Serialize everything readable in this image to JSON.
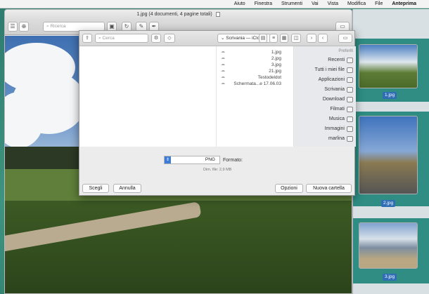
{
  "menubar": {
    "items": [
      "Anteprima",
      "File",
      "Modifica",
      "Vista",
      "Vai",
      "Strumenti",
      "Finestra",
      "Aiuto"
    ]
  },
  "window": {
    "title": "1.jpg (4 documenti, 4 pagine totali)",
    "search_placeholder": "Ricerca"
  },
  "thumbnails": [
    {
      "label": "1.jpg"
    },
    {
      "label": "2.jpg"
    },
    {
      "label": "3.jpg"
    }
  ],
  "dialog": {
    "search_placeholder": "Cerca",
    "location": "Scrivania — iCloud",
    "files": [
      "1.jpg",
      "2.jpg",
      "3.jpg",
      "21.jpg",
      "Testodeldot",
      "Schermata...e 17.06.03"
    ],
    "sidebar_header": "Preferiti",
    "sidebar_items": [
      "Recenti",
      "Tutti i miei file",
      "Applicazioni",
      "Scrivania",
      "Download",
      "Filmati",
      "Musica",
      "Immagini",
      "marlina"
    ],
    "format_label": "Formato:",
    "format_value": "PNG",
    "file_size": "Dim. file: 2,9 MB",
    "buttons": {
      "new_folder": "Nuova cartella",
      "options": "Opzioni",
      "cancel": "Annulla",
      "choose": "Scegli"
    }
  }
}
